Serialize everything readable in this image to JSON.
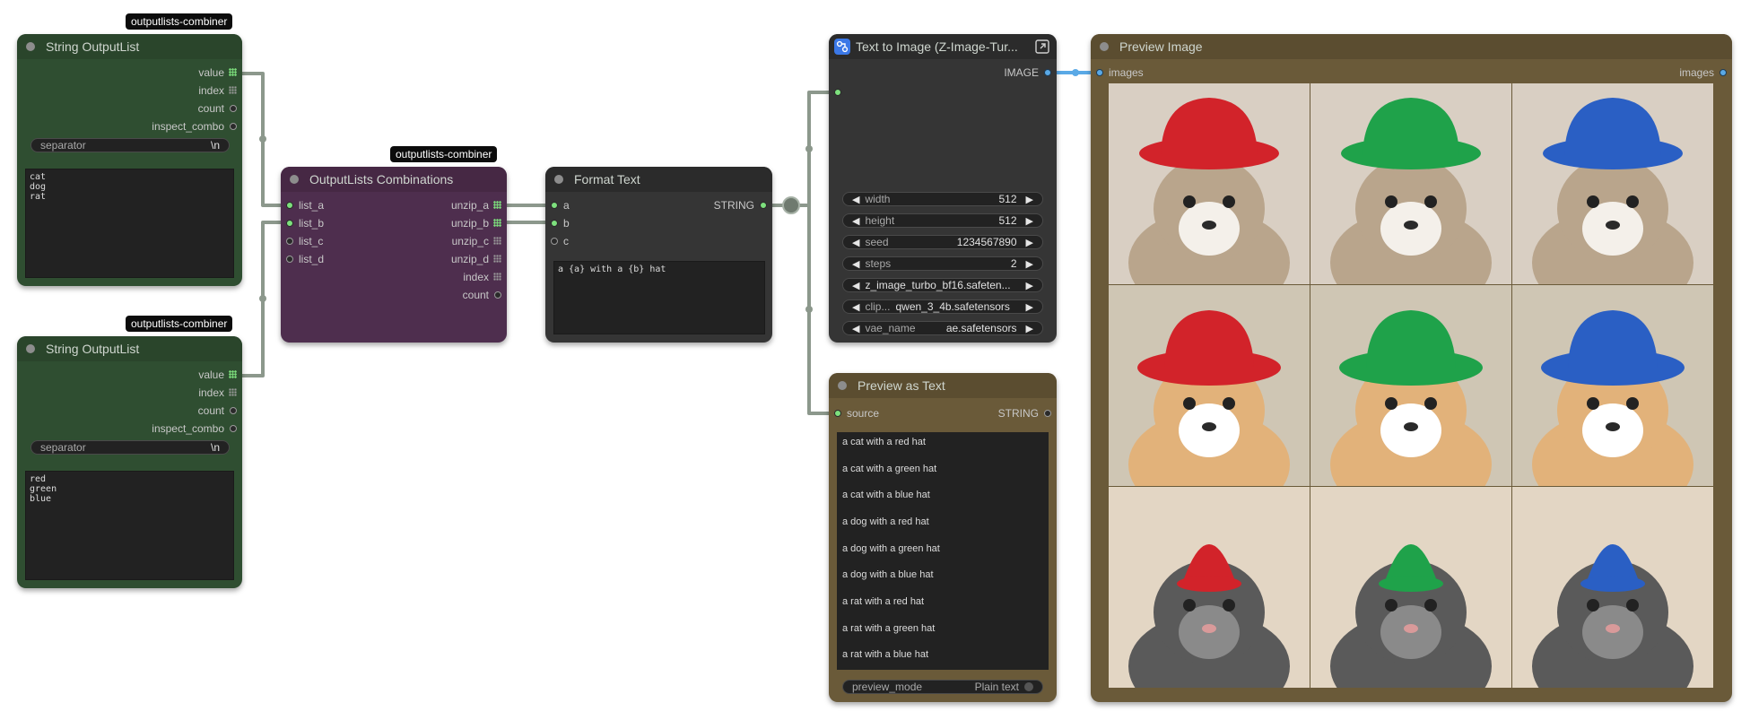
{
  "tags": {
    "combiner": "outputlists-combiner"
  },
  "node_string1": {
    "title": "String OutputList",
    "outputs": [
      "value",
      "index",
      "count",
      "inspect_combo"
    ],
    "separator_label": "separator",
    "separator_value": "\\n",
    "text": "cat\ndog\nrat"
  },
  "node_string2": {
    "title": "String OutputList",
    "outputs": [
      "value",
      "index",
      "count",
      "inspect_combo"
    ],
    "separator_label": "separator",
    "separator_value": "\\n",
    "text": "red\ngreen\nblue"
  },
  "node_combo": {
    "title": "OutputLists Combinations",
    "inputs": [
      "list_a",
      "list_b",
      "list_c",
      "list_d"
    ],
    "outputs": [
      "unzip_a",
      "unzip_b",
      "unzip_c",
      "unzip_d",
      "index",
      "count"
    ]
  },
  "node_format": {
    "title": "Format Text",
    "inputs": [
      "a",
      "b",
      "c"
    ],
    "output": "STRING",
    "template": "a {a} with a {b} hat"
  },
  "node_t2i": {
    "title": "Text to Image (Z-Image-Tur...",
    "output": "IMAGE",
    "widgets": [
      {
        "label": "width",
        "value": "512"
      },
      {
        "label": "height",
        "value": "512"
      },
      {
        "label": "seed",
        "value": "1234567890"
      },
      {
        "label": "steps",
        "value": "2"
      },
      {
        "label": "",
        "value": "z_image_turbo_bf16.safeten..."
      },
      {
        "label": "clip...",
        "value": "qwen_3_4b.safetensors"
      },
      {
        "label": "vae_name",
        "value": "ae.safetensors"
      }
    ]
  },
  "node_preview_text": {
    "title": "Preview as Text",
    "input": "source",
    "output": "STRING",
    "lines": [
      "a cat with a red hat",
      "a cat with a green hat",
      "a cat with a blue hat",
      "a dog with a red hat",
      "a dog with a green hat",
      "a dog with a blue hat",
      "a rat with a red hat",
      "a rat with a green hat",
      "a rat with a blue hat"
    ],
    "mode_label": "preview_mode",
    "mode_value": "Plain text"
  },
  "node_preview_image": {
    "title": "Preview Image",
    "input": "images",
    "output": "images",
    "grid": [
      {
        "animal": "cat",
        "hat": "red",
        "color": "#d2232a"
      },
      {
        "animal": "cat",
        "hat": "green",
        "color": "#1fa24a"
      },
      {
        "animal": "cat",
        "hat": "blue",
        "color": "#2a5fc4"
      },
      {
        "animal": "dog",
        "hat": "red",
        "color": "#d2232a"
      },
      {
        "animal": "dog",
        "hat": "green",
        "color": "#1fa24a"
      },
      {
        "animal": "dog",
        "hat": "blue",
        "color": "#2a5fc4"
      },
      {
        "animal": "rat",
        "hat": "red",
        "color": "#d2232a"
      },
      {
        "animal": "rat",
        "hat": "green",
        "color": "#1fa24a"
      },
      {
        "animal": "rat",
        "hat": "blue",
        "color": "#2a5fc4"
      }
    ]
  }
}
